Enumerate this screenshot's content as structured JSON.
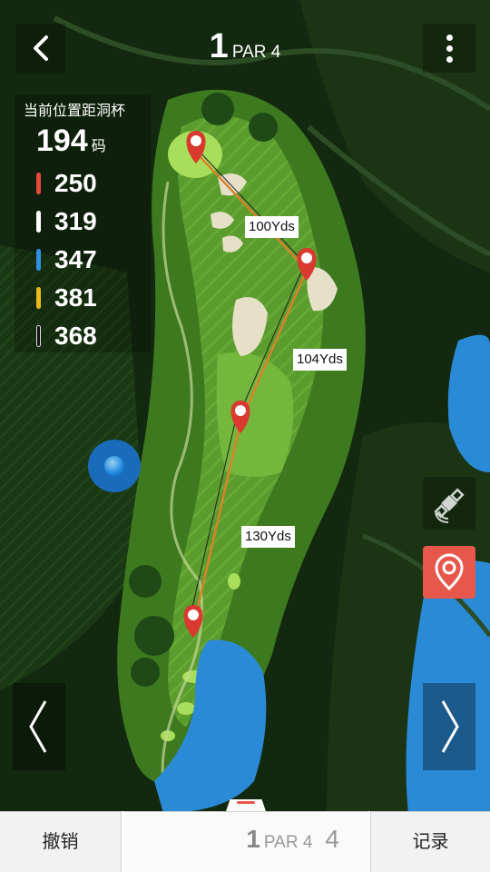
{
  "header": {
    "hole_number": "1",
    "par_label": "PAR 4"
  },
  "distances": {
    "label": "当前位置距洞杯",
    "current_value": "194",
    "current_unit": "码",
    "tees": [
      {
        "color": "#e8473b",
        "value": "250"
      },
      {
        "color": "#ffffff",
        "value": "319"
      },
      {
        "color": "#2f8fe0",
        "value": "347"
      },
      {
        "color": "#e8b81c",
        "value": "381"
      },
      {
        "color": "#111111",
        "value": "368"
      }
    ]
  },
  "map": {
    "segments": [
      {
        "label": "100Yds"
      },
      {
        "label": "104Yds"
      },
      {
        "label": "130Yds"
      }
    ]
  },
  "bottom": {
    "cancel_label": "撤销",
    "hole_number": "1",
    "par_label": "PAR 4",
    "score": "4",
    "record_label": "记录"
  },
  "colors": {
    "accent": "#e8574c",
    "fairway": "#4f8f2a",
    "green": "#a9dd5c",
    "water": "#2b8ad6"
  }
}
